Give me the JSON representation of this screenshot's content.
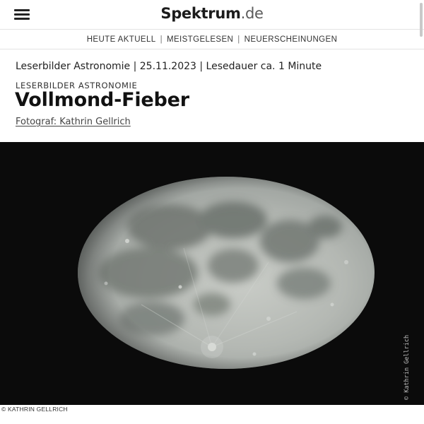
{
  "header": {
    "logo_brand": "Spektrum",
    "logo_tld": ".de",
    "menu_icon": "hamburger-menu-icon"
  },
  "subnav": {
    "items": [
      {
        "label": "HEUTE AKTUELL"
      },
      {
        "label": "MEISTGELESEN"
      },
      {
        "label": "NEUERSCHEINUNGEN"
      }
    ],
    "separator": "|"
  },
  "article": {
    "meta": "Leserbilder Astronomie | 25.11.2023 | Lesedauer ca. 1 Minute",
    "kicker": "LESERBILDER ASTRONOMIE",
    "title": "Vollmond-Fieber",
    "photographer": "Fotograf: Kathrin Gellrich"
  },
  "photo": {
    "watermark": "© Kathrin Gellrich",
    "caption": "© KATHRIN GELLRICH",
    "background": "#0b0b0b"
  }
}
